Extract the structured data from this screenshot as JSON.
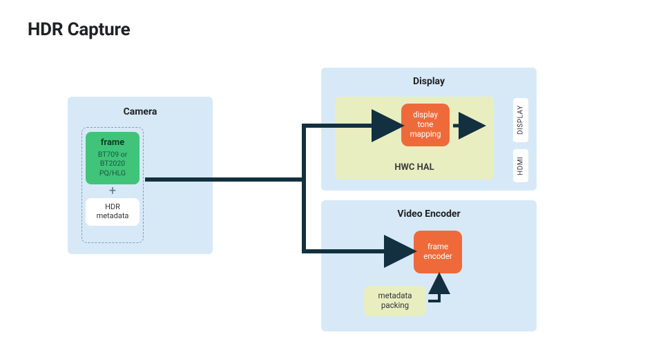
{
  "title": "HDR Capture",
  "camera": {
    "title": "Camera",
    "frame_title": "frame",
    "frame_line1": "BT709 or",
    "frame_line2": "BT2020",
    "frame_line3": "PQ/HLG",
    "plus": "+",
    "hdr_meta_line1": "HDR",
    "hdr_meta_line2": "metadata"
  },
  "display": {
    "title": "Display",
    "hwc_label": "HWC HAL",
    "tone_line1": "display",
    "tone_line2": "tone",
    "tone_line3": "mapping",
    "side_display": "DISPLAY",
    "side_hdmi": "HDMI"
  },
  "encoder": {
    "title": "Video Encoder",
    "enc_line1": "frame",
    "enc_line2": "encoder",
    "meta_line1": "metadata",
    "meta_line2": "packing"
  }
}
